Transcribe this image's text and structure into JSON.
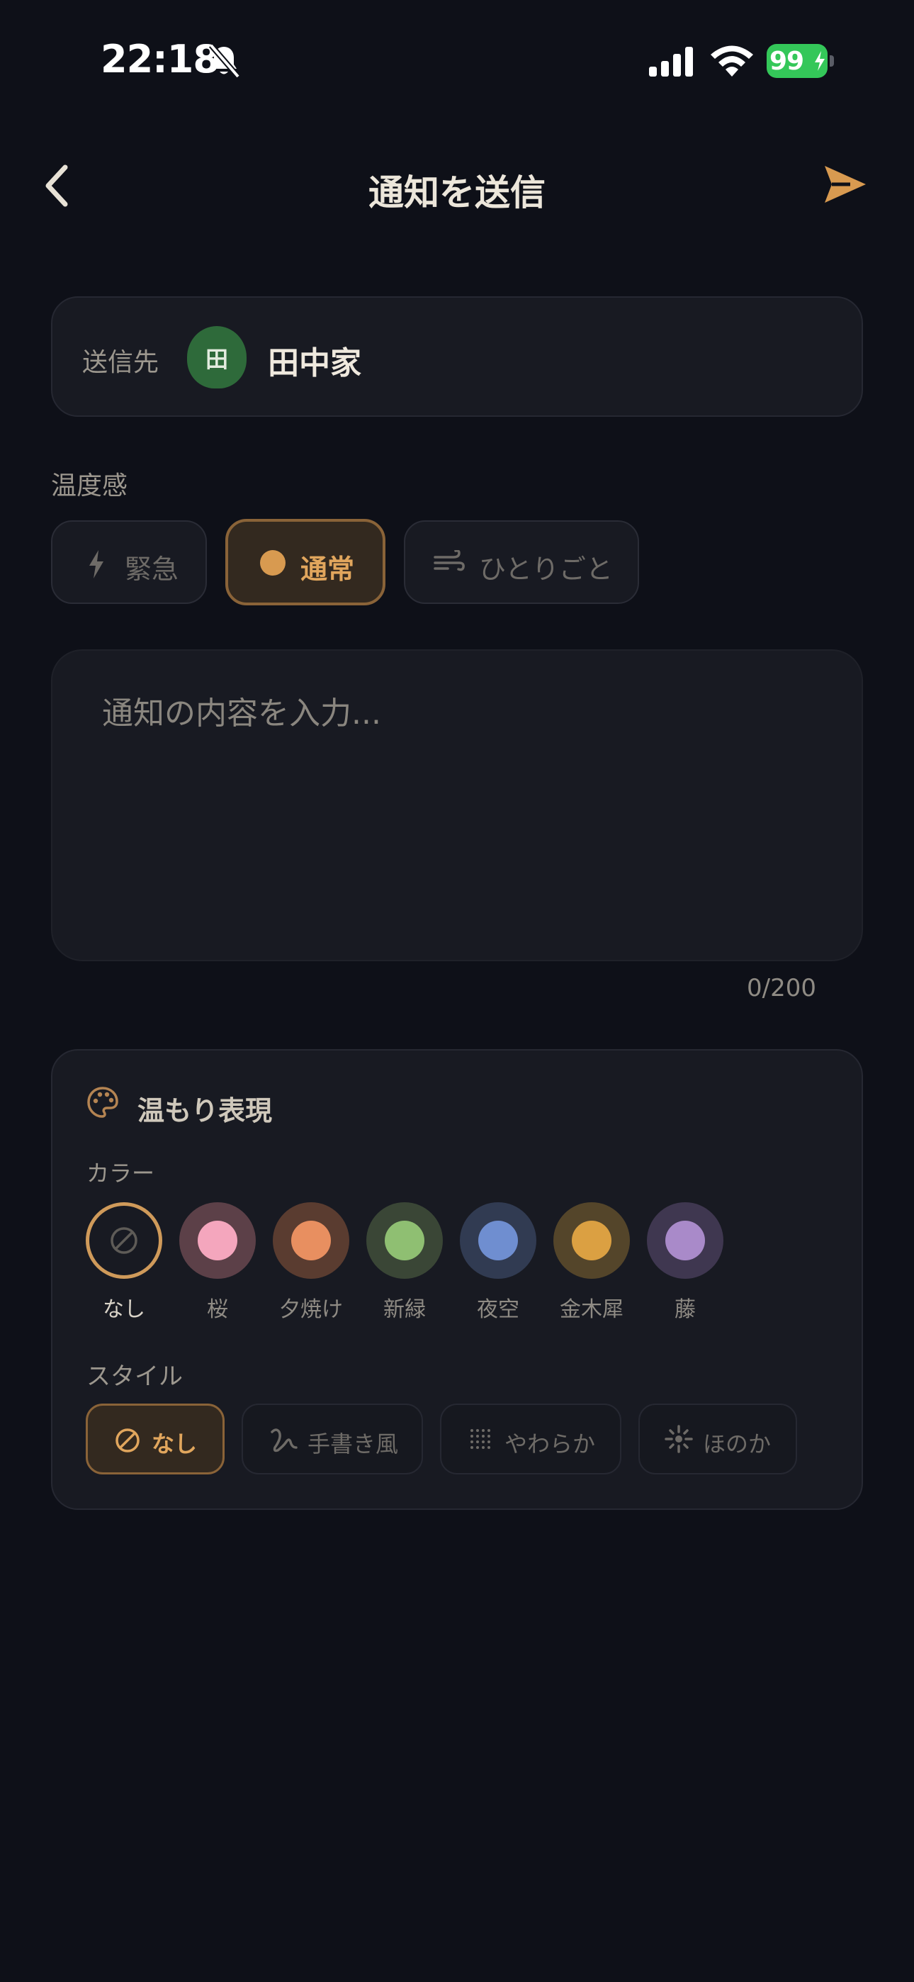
{
  "status_bar": {
    "time": "22:18",
    "battery": "99"
  },
  "header": {
    "title": "通知を送信"
  },
  "recipient": {
    "label": "送信先",
    "avatar_text": "田",
    "name": "田中家"
  },
  "temperature": {
    "label": "温度感",
    "options": [
      {
        "label": "緊急",
        "icon": "bolt-icon",
        "selected": false
      },
      {
        "label": "通常",
        "icon": "dot-icon",
        "selected": true
      },
      {
        "label": "ひとりごと",
        "icon": "wind-icon",
        "selected": false
      }
    ]
  },
  "message": {
    "placeholder": "通知の内容を入力...",
    "counter": "0/200"
  },
  "warmth": {
    "title": "温もり表現",
    "color_label": "カラー",
    "colors": [
      {
        "label": "なし",
        "swatch": null,
        "selected": true
      },
      {
        "label": "桜",
        "swatch": "#f4a6bd",
        "ring": "#5c4048"
      },
      {
        "label": "夕焼け",
        "swatch": "#e88f60",
        "ring": "#5a3c30"
      },
      {
        "label": "新緑",
        "swatch": "#8fbf72",
        "ring": "#3a4636"
      },
      {
        "label": "夜空",
        "swatch": "#6f8ed0",
        "ring": "#313b52"
      },
      {
        "label": "金木犀",
        "swatch": "#dba042",
        "ring": "#54452a"
      },
      {
        "label": "藤",
        "swatch": "#a98ac9",
        "ring": "#3f3750"
      }
    ],
    "style_label": "スタイル",
    "styles": [
      {
        "label": "なし",
        "icon": "ban-icon",
        "selected": true
      },
      {
        "label": "手書き風",
        "icon": "scribble-icon",
        "selected": false
      },
      {
        "label": "やわらか",
        "icon": "dots-grid-icon",
        "selected": false
      },
      {
        "label": "ほのか",
        "icon": "sparkle-icon",
        "selected": false
      }
    ]
  },
  "colors": {
    "accent": "#d89a50",
    "background": "#0e1018",
    "card": "#181a22"
  }
}
